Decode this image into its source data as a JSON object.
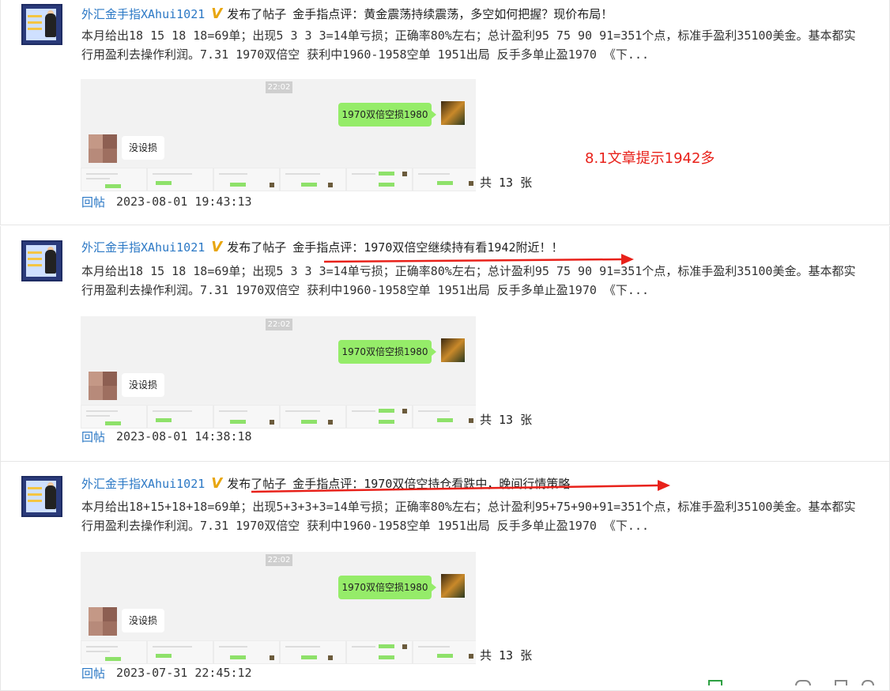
{
  "posts": [
    {
      "author": "外汇金手指XAhui1021",
      "badge": "V",
      "verb": "发布了帖子",
      "title": "金手指点评：黄金震荡持续震荡，多空如何把握？现价布局！",
      "summary": "本月给出18 15 18 18=69单；出现5 3 3 3=14单亏损；正确率80%左右；总计盈利95 75 90 91=351个点，标准手盈利35100美金。基本都实行用盈利去操作利润。7.31 1970双倍空 获利中1960-1958空单 1951出局 反手多单止盈1970 《下...",
      "chat": {
        "time": "22:02",
        "my_message": "1970双倍空损1980",
        "other_message": "没设损"
      },
      "image_count": "共 13 张",
      "reply_label": "回帖",
      "timestamp": "2023-08-01 19:43:13"
    },
    {
      "author": "外汇金手指XAhui1021",
      "badge": "V",
      "verb": "发布了帖子",
      "title": "金手指点评：1970双倍空继续持有看1942附近！！",
      "summary": "本月给出18 15 18 18=69单；出现5 3 3 3=14单亏损；正确率80%左右；总计盈利95 75 90 91=351个点，标准手盈利35100美金。基本都实行用盈利去操作利润。7.31 1970双倍空 获利中1960-1958空单 1951出局 反手多单止盈1970 《下...",
      "chat": {
        "time": "22:02",
        "my_message": "1970双倍空损1980",
        "other_message": "没设损"
      },
      "image_count": "共 13 张",
      "reply_label": "回帖",
      "timestamp": "2023-08-01 14:38:18"
    },
    {
      "author": "外汇金手指XAhui1021",
      "badge": "V",
      "verb": "发布了帖子",
      "title": "金手指点评：1970双倍空持仓看跌中，晚间行情策略",
      "summary": "本月给出18+15+18+18=69单；出现5+3+3+3=14单亏损；正确率80%左右；总计盈利95+75+90+91=351个点，标准手盈利35100美金。基本都实行用盈利去操作利润。7.31 1970双倍空 获利中1960-1958空单 1951出局 反手多单止盈1970 《下...",
      "chat": {
        "time": "22:02",
        "my_message": "1970双倍空损1980",
        "other_message": "没设损"
      },
      "image_count": "共 13 张",
      "reply_label": "回帖",
      "timestamp": "2023-07-31 22:45:12"
    }
  ],
  "annotation": "8.1文章提示1942多",
  "colors": {
    "link": "#2b78c5",
    "annotation_red": "#e8211a",
    "chat_green": "#95ec69",
    "badge_gold": "#e8a60f"
  }
}
